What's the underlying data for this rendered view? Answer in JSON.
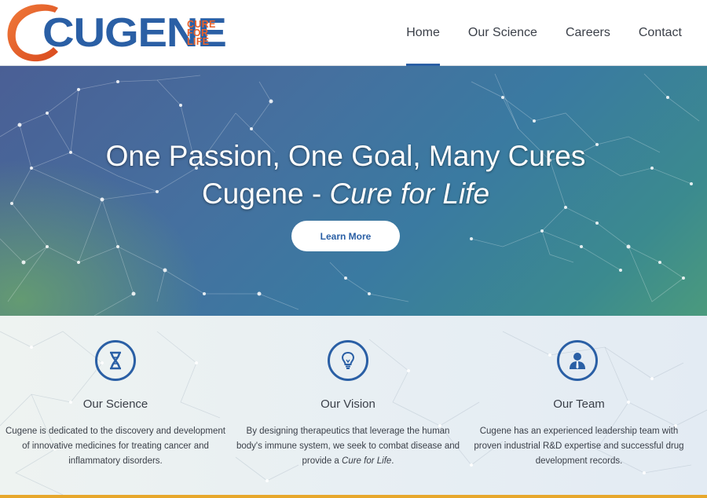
{
  "logo": {
    "word": "Cugene",
    "tag": [
      "CURE",
      "FOR",
      "LIFE"
    ]
  },
  "nav": [
    {
      "label": "Home"
    },
    {
      "label": "Our Science"
    },
    {
      "label": "Careers"
    },
    {
      "label": "Contact"
    }
  ],
  "hero": {
    "title": "One Passion, One Goal, Many Cures",
    "subtitle_prefix": "Cugene - ",
    "subtitle_em": "Cure for Life",
    "button": "Learn More"
  },
  "features": [
    {
      "icon": "dna-icon",
      "title": "Our Science",
      "text": "Cugene is dedicated to the discovery and development of innovative medicines for treating cancer and inflammatory disorders."
    },
    {
      "icon": "lightbulb-icon",
      "title": "Our Vision",
      "text_prefix": "By designing therapeutics that leverage the human body's immune system, we seek to combat disease and provide a ",
      "text_em": "Cure for Life",
      "text_suffix": "."
    },
    {
      "icon": "person-icon",
      "title": "Our Team",
      "text": "Cugene has an experienced leadership team with proven industrial R&D expertise and successful drug development records."
    }
  ],
  "colors": {
    "brand_blue": "#2a5fa5",
    "brand_orange": "#e8622c",
    "accent_bar": "#e7a72b"
  }
}
